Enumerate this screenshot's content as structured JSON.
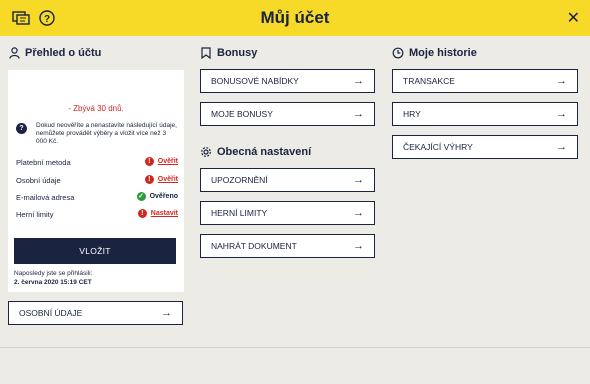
{
  "header": {
    "title": "Můj účet",
    "close_glyph": "✕",
    "help_glyph": "?"
  },
  "overview": {
    "title": "Přehled o účtu",
    "remaining": "- Zbývá 30 dnů.",
    "info_text": "Dokud neověříte a nenastavíte následující údaje, nemůžete provádět výběry a vložit více než 3 000 Kč.",
    "rows": [
      {
        "label": "Platební metoda",
        "status": "Ověřit",
        "state": "error"
      },
      {
        "label": "Osobní údaje",
        "status": "Ověřit",
        "state": "error"
      },
      {
        "label": "E-mailová adresa",
        "status": "Ověřeno",
        "state": "ok"
      },
      {
        "label": "Herní limity",
        "status": "Nastavit",
        "state": "error"
      }
    ],
    "deposit_label": "VLOŽIT",
    "last_login_label": "Naposledy jste se přihlásili:",
    "last_login_value": "2. června 2020 15:19 CET",
    "personal_button": "OSOBNÍ ÚDAJE"
  },
  "bonuses": {
    "title": "Bonusy",
    "items": [
      "BONUSOVÉ NABÍDKY",
      "MOJE BONUSY"
    ]
  },
  "general": {
    "title": "Obecná nastavení",
    "items": [
      "UPOZORNĚNÍ",
      "HERNÍ LIMITY",
      "NAHRÁT DOKUMENT"
    ]
  },
  "history": {
    "title": "Moje historie",
    "items": [
      "TRANSAKCE",
      "HRY",
      "ČEKAJÍCÍ VÝHRY"
    ]
  },
  "arrow_glyph": "→",
  "colors": {
    "brand_yellow": "#f7d928",
    "navy": "#1a2340",
    "error_red": "#d0281f",
    "ok_green": "#2b9a37",
    "background": "#ecebe5"
  }
}
